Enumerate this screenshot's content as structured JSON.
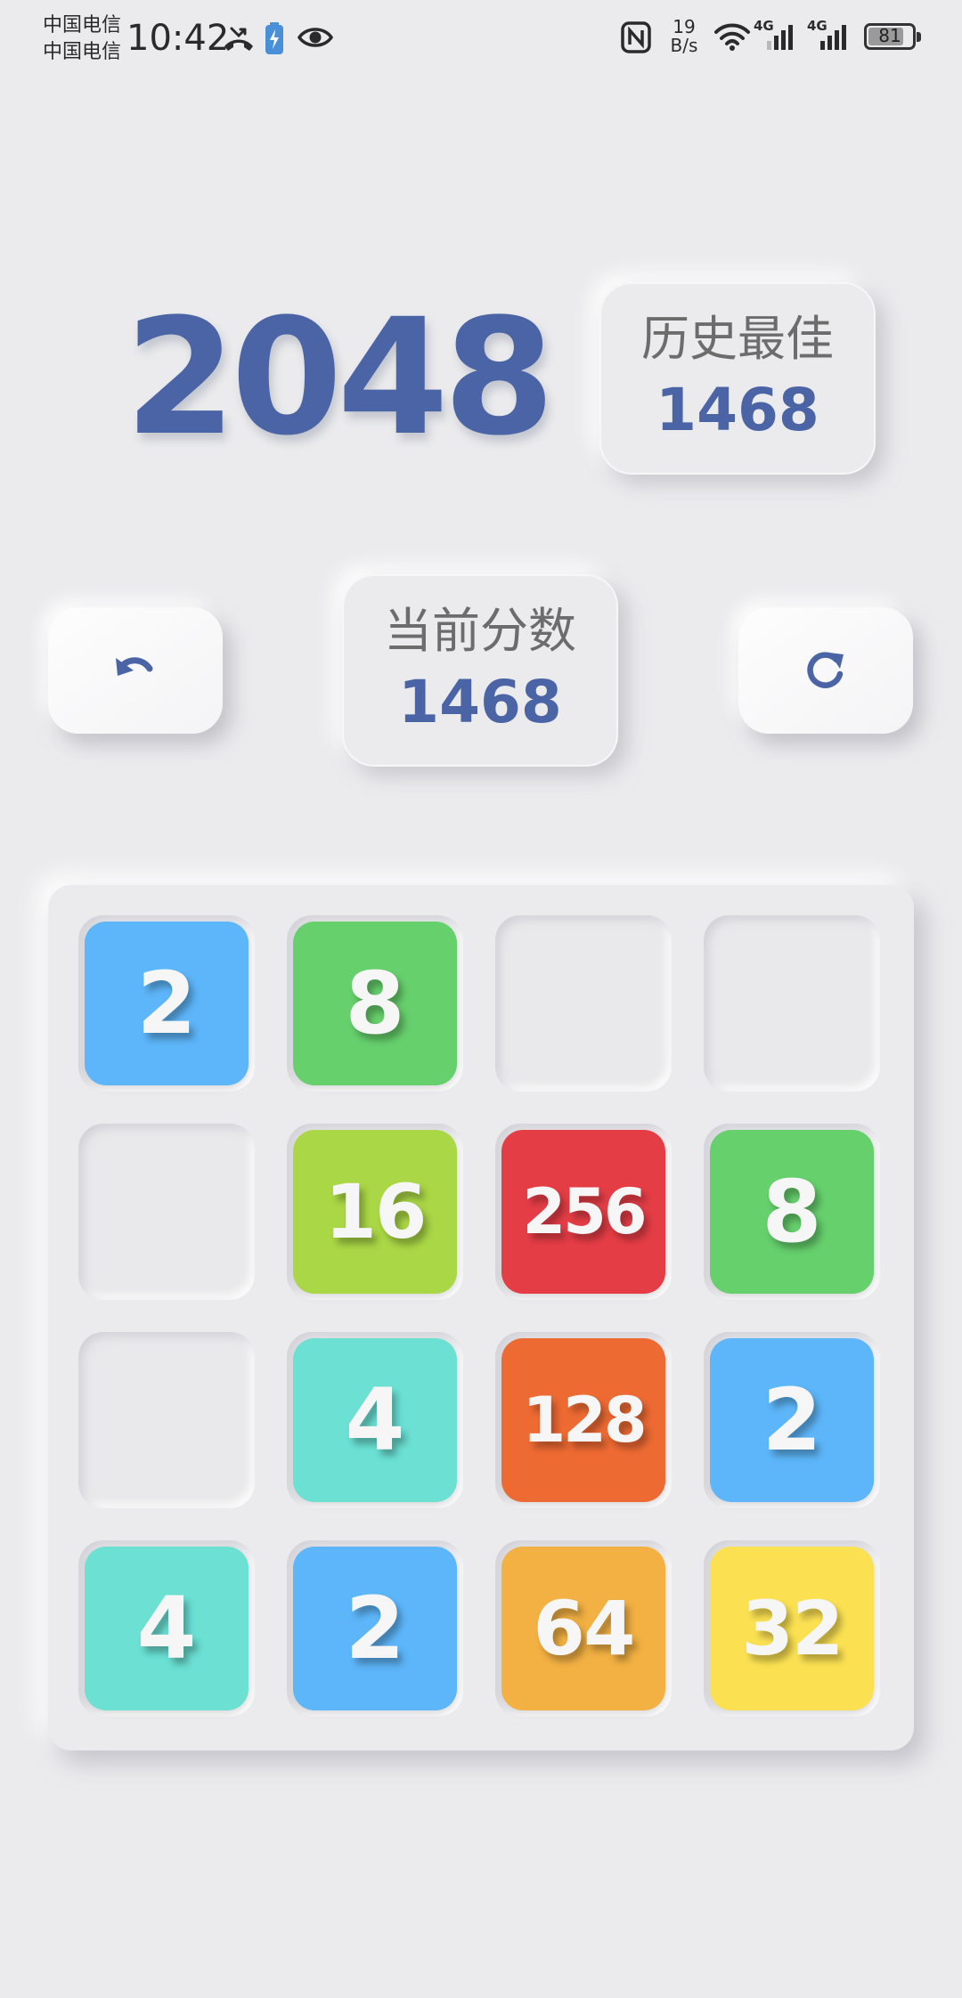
{
  "status_bar": {
    "carrier_1": "中国电信",
    "carrier_2": "中国电信",
    "time": "10:42",
    "net_speed_value": "19",
    "net_speed_unit": "B/s",
    "signal_label_1": "4G",
    "signal_label_2": "4G",
    "battery_level": "81",
    "icons": [
      "missed-call-icon",
      "battery-saver-icon",
      "eye-icon",
      "nfc-icon",
      "wifi-icon",
      "signal-icon",
      "signal-icon",
      "battery-icon"
    ]
  },
  "header": {
    "title": "2048",
    "best": {
      "label": "历史最佳",
      "value": "1468"
    },
    "current": {
      "label": "当前分数",
      "value": "1468"
    }
  },
  "controls": {
    "undo_icon": "undo-icon",
    "restart_icon": "restart-icon"
  },
  "board": {
    "rows": [
      [
        "2",
        "8",
        "",
        ""
      ],
      [
        "",
        "16",
        "256",
        "8"
      ],
      [
        "",
        "4",
        "128",
        "2"
      ],
      [
        "4",
        "2",
        "64",
        "32"
      ]
    ],
    "tile_colors": {
      "2": "#5db6f9",
      "4": "#6be0d3",
      "8": "#66d06c",
      "16": "#aad745",
      "32": "#fbe152",
      "64": "#f3b143",
      "128": "#ee6a33",
      "256": "#e53d45"
    }
  },
  "colors": {
    "background": "#ebebed",
    "accent": "#4a64a6",
    "label": "#6c6c6c"
  }
}
